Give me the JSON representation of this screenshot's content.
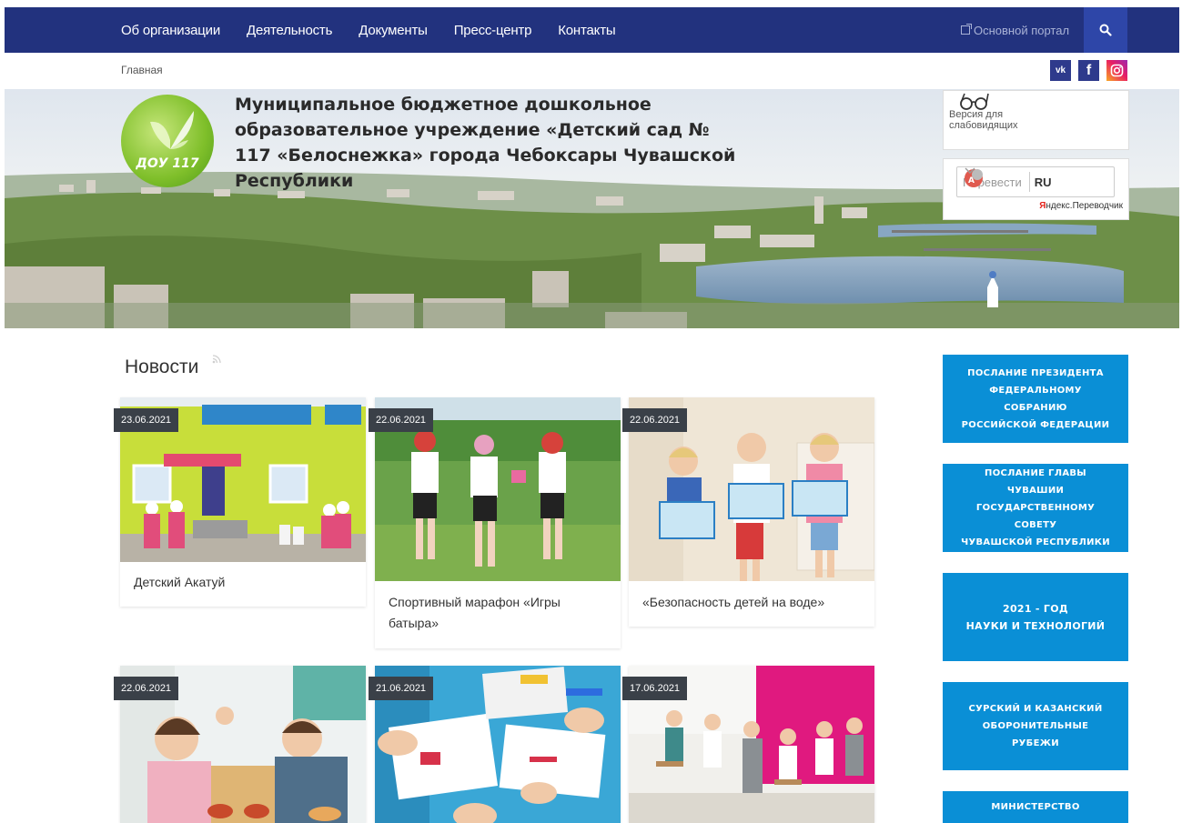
{
  "nav": {
    "items": [
      "Об организации",
      "Деятельность",
      "Документы",
      "Пресс-центр",
      "Контакты"
    ],
    "portal_link": "Основной портал"
  },
  "breadcrumb": "Главная",
  "social": {
    "vk": "vk",
    "fb": "f"
  },
  "header": {
    "logo_text": "ДОУ 117",
    "org_title": "Муниципальное бюджетное дошкольное образовательное учреждение «Детский сад № 117 «Белоснежка» города Чебоксары Чувашской Республики",
    "vision_label": "Версия для слабовидящих",
    "translate_label": "Перевести",
    "translate_lang": "RU",
    "translate_provider_red": "Я",
    "translate_provider_rest": "ндекс.Переводчик"
  },
  "news": {
    "heading": "Новости",
    "items": [
      {
        "date": "23.06.2021",
        "title": "Детский Акатуй"
      },
      {
        "date": "22.06.2021",
        "title": "Спортивный марафон «Игры батыра»"
      },
      {
        "date": "22.06.2021",
        "title": "«Безопасность детей на воде»"
      },
      {
        "date": "22.06.2021",
        "title": ""
      },
      {
        "date": "21.06.2021",
        "title": ""
      },
      {
        "date": "17.06.2021",
        "title": ""
      }
    ]
  },
  "sidebar": {
    "banners": [
      "ПОСЛАНИЕ ПРЕЗИДЕНТА\nФЕДЕРАЛЬНОМУ СОБРАНИЮ\nРОССИЙСКОЙ ФЕДЕРАЦИИ",
      "ПОСЛАНИЕ ГЛАВЫ ЧУВАШИИ\nГОСУДАРСТВЕННОМУ СОВЕТУ\nЧУВАШСКОЙ РЕСПУБЛИКИ",
      "2021 - ГОД\nНАУКИ И ТЕХНОЛОГИЙ",
      "СУРСКИЙ И КАЗАНСКИЙ\nОБОРОНИТЕЛЬНЫЕ РУБЕЖИ",
      "МИНИСТЕРСТВО"
    ]
  },
  "colors": {
    "nav_bg": "#22327e",
    "search_bg": "#2e46a8",
    "sidebar_banner": "#0a8fd6",
    "date_badge": "#3a4048"
  }
}
